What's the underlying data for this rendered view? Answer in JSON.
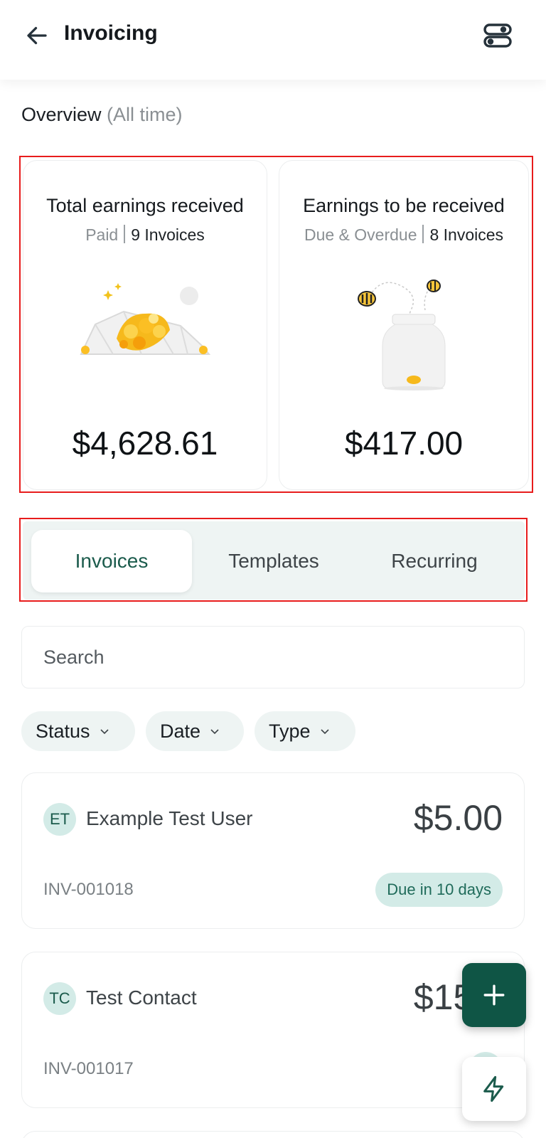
{
  "header": {
    "title": "Invoicing",
    "back_icon": "arrow-left-icon",
    "settings_icon": "toggles-icon"
  },
  "overview": {
    "label": "Overview",
    "period": "(All time)"
  },
  "cards": [
    {
      "title": "Total earnings received",
      "status": "Paid",
      "count": "9 Invoices",
      "amount": "$4,628.61",
      "illustration": "gold-coins-pile"
    },
    {
      "title": "Earnings to be received",
      "status": "Due & Overdue",
      "count": "8 Invoices",
      "amount": "$417.00",
      "illustration": "bees-jar"
    }
  ],
  "tabs": [
    {
      "label": "Invoices",
      "active": true
    },
    {
      "label": "Templates",
      "active": false
    },
    {
      "label": "Recurring",
      "active": false
    }
  ],
  "search": {
    "placeholder": "Search"
  },
  "filters": [
    {
      "label": "Status"
    },
    {
      "label": "Date"
    },
    {
      "label": "Type"
    }
  ],
  "invoices": [
    {
      "initials": "ET",
      "contact": "Example Test User",
      "amount": "$5.00",
      "number": "INV-001018",
      "status": "Due in 10 days"
    },
    {
      "initials": "TC",
      "contact": "Test Contact",
      "amount": "$15.0",
      "number": "INV-001017",
      "status": "D"
    }
  ],
  "colors": {
    "accent": "#0f5545",
    "tab_bg": "#eef4f3",
    "badge_bg": "#d3ebe7",
    "highlight": "#e81c1c"
  }
}
